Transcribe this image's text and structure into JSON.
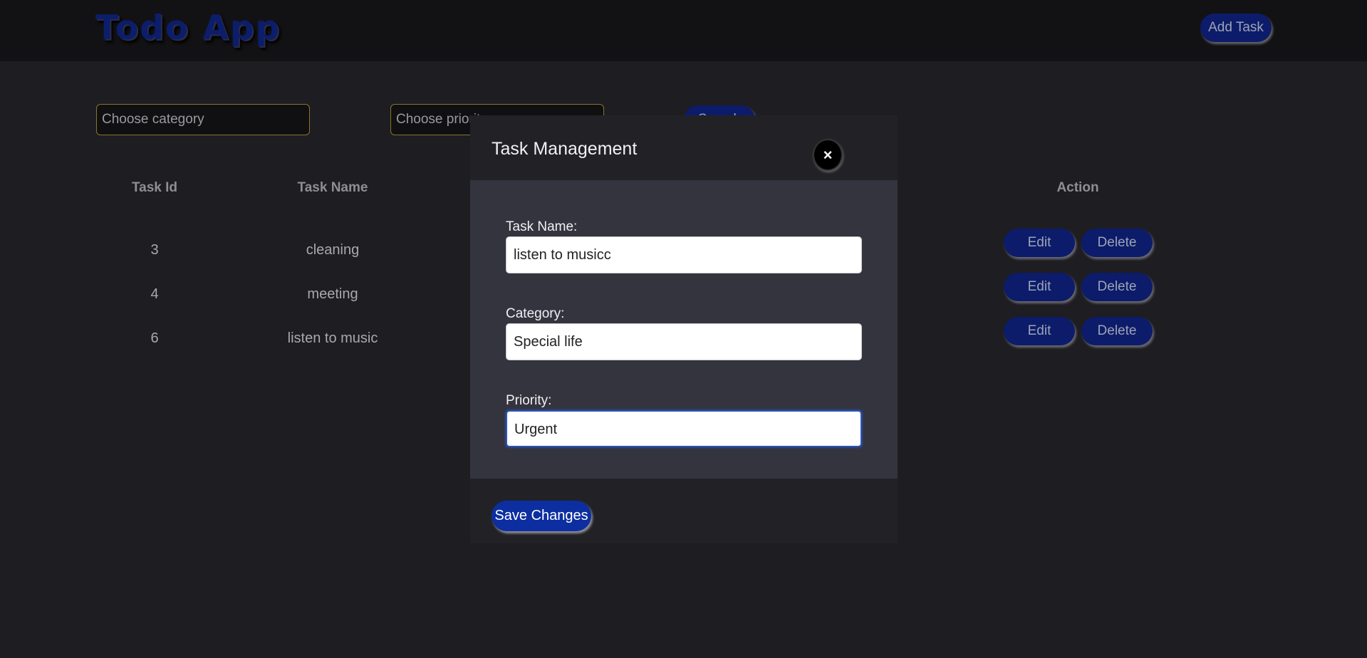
{
  "header": {
    "app_title": "Todo App",
    "add_task_label": "Add Task"
  },
  "filters": {
    "category_placeholder": "Choose category",
    "priority_placeholder": "Choose priority",
    "search_label": "Search"
  },
  "table": {
    "columns": [
      "Task Id",
      "Task Name",
      "Action"
    ],
    "rows": [
      {
        "id": "3",
        "name": "cleaning"
      },
      {
        "id": "4",
        "name": "meeting"
      },
      {
        "id": "6",
        "name": "listen to music"
      }
    ],
    "edit_label": "Edit",
    "delete_label": "Delete"
  },
  "modal": {
    "title": "Task Management",
    "close_icon": "×",
    "fields": [
      {
        "label": "Task Name:",
        "value": "listen to musicc"
      },
      {
        "label": "Category:",
        "value": "Special life"
      },
      {
        "label": "Priority:",
        "value": "Urgent"
      }
    ],
    "save_label": "Save Changes"
  },
  "colors": {
    "background": "#1e1d22",
    "accent": "#0c1c6a",
    "modal_body": "#34343f"
  }
}
